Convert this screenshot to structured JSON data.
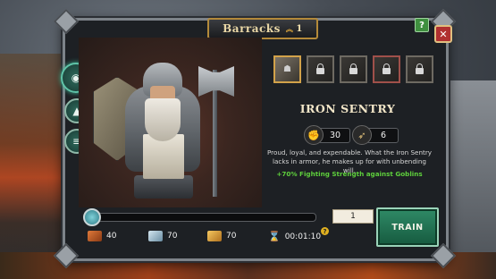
{
  "window": {
    "title": "Barracks",
    "level": "1",
    "help_label": "?",
    "close_label": "✕"
  },
  "side_nav": [
    {
      "name": "view",
      "icon": "eye-icon",
      "glyph": "◉"
    },
    {
      "name": "upgrade",
      "icon": "arrow-up-icon",
      "glyph": "▲"
    },
    {
      "name": "list",
      "icon": "list-icon",
      "glyph": "≡"
    }
  ],
  "units": [
    {
      "name": "Iron Sentry",
      "state": "selected"
    },
    {
      "name": "",
      "state": "locked"
    },
    {
      "name": "",
      "state": "locked"
    },
    {
      "name": "",
      "state": "locked"
    },
    {
      "name": "",
      "state": "locked"
    }
  ],
  "unit": {
    "name": "IRON SENTRY",
    "attack": "30",
    "attack_icon": "fist-icon",
    "speed": "6",
    "speed_icon": "boot-icon",
    "description": "Proud, loyal, and expendable. What the Iron Sentry lacks in armor, he makes up for with unbending will.",
    "bonus": "+70% Fighting Strength against Goblins"
  },
  "training": {
    "slider_value": 0,
    "quantity": "1",
    "train_label": "TRAIN"
  },
  "costs": [
    {
      "resource": "wood",
      "icon": "wood-icon",
      "value": "40",
      "color": "#c8642a"
    },
    {
      "resource": "iron",
      "icon": "iron-ingot-icon",
      "value": "70",
      "color": "#9fc4d8"
    },
    {
      "resource": "wheat",
      "icon": "wheat-icon",
      "value": "70",
      "color": "#e3a94a"
    }
  ],
  "time": {
    "icon": "hourglass-icon",
    "value": "00:01:10"
  }
}
